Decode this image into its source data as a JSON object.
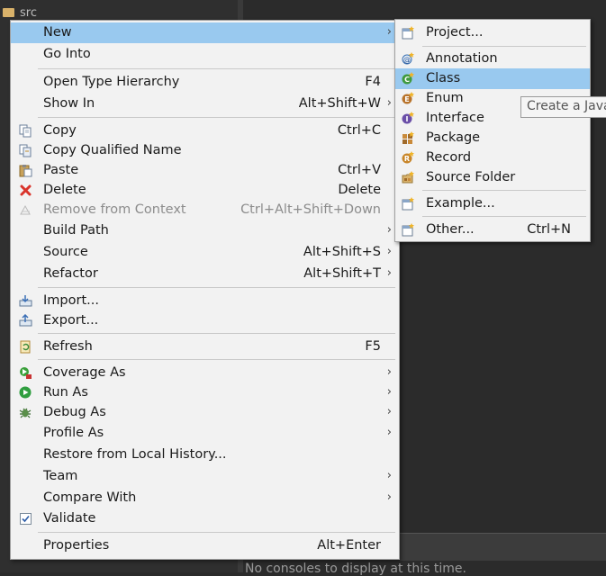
{
  "background": {
    "tree_item_label": "src",
    "console_message": "No consoles to display at this time."
  },
  "context_menu": {
    "items": [
      {
        "label": "New",
        "shortcut": "",
        "submenu": true,
        "icon": "",
        "highlighted": true
      },
      {
        "label": "Go Into",
        "shortcut": ""
      },
      {
        "label": "Open Type Hierarchy",
        "shortcut": "F4"
      },
      {
        "label": "Show In",
        "shortcut": "Alt+Shift+W",
        "submenu": true
      },
      {
        "label": "Copy",
        "shortcut": "Ctrl+C",
        "icon": "copy-icon"
      },
      {
        "label": "Copy Qualified Name",
        "shortcut": "",
        "icon": "copy-qualified-name-icon"
      },
      {
        "label": "Paste",
        "shortcut": "Ctrl+V",
        "icon": "paste-icon"
      },
      {
        "label": "Delete",
        "shortcut": "Delete",
        "icon": "delete-icon"
      },
      {
        "label": "Remove from Context",
        "shortcut": "Ctrl+Alt+Shift+Down",
        "icon": "remove-from-context-icon",
        "disabled": true
      },
      {
        "label": "Build Path",
        "shortcut": "",
        "submenu": true
      },
      {
        "label": "Source",
        "shortcut": "Alt+Shift+S",
        "submenu": true
      },
      {
        "label": "Refactor",
        "shortcut": "Alt+Shift+T",
        "submenu": true
      },
      {
        "label": "Import...",
        "shortcut": "",
        "icon": "import-icon"
      },
      {
        "label": "Export...",
        "shortcut": "",
        "icon": "export-icon"
      },
      {
        "label": "Refresh",
        "shortcut": "F5",
        "icon": "refresh-icon"
      },
      {
        "label": "Coverage As",
        "shortcut": "",
        "submenu": true,
        "icon": "coverage-icon"
      },
      {
        "label": "Run As",
        "shortcut": "",
        "submenu": true,
        "icon": "run-icon"
      },
      {
        "label": "Debug As",
        "shortcut": "",
        "submenu": true,
        "icon": "debug-icon"
      },
      {
        "label": "Profile As",
        "shortcut": "",
        "submenu": true
      },
      {
        "label": "Restore from Local History...",
        "shortcut": ""
      },
      {
        "label": "Team",
        "shortcut": "",
        "submenu": true
      },
      {
        "label": "Compare With",
        "shortcut": "",
        "submenu": true
      },
      {
        "label": "Validate",
        "shortcut": "",
        "icon": "checkbox-icon"
      },
      {
        "label": "Properties",
        "shortcut": "Alt+Enter"
      }
    ]
  },
  "new_submenu": {
    "items": [
      {
        "label": "Project...",
        "shortcut": "",
        "icon": "new-project-icon"
      },
      {
        "label": "Annotation",
        "shortcut": "",
        "icon": "annotation-icon"
      },
      {
        "label": "Class",
        "shortcut": "",
        "icon": "class-icon",
        "highlighted": true
      },
      {
        "label": "Enum",
        "shortcut": "",
        "icon": "enum-icon"
      },
      {
        "label": "Interface",
        "shortcut": "",
        "icon": "interface-icon"
      },
      {
        "label": "Package",
        "shortcut": "",
        "icon": "package-icon"
      },
      {
        "label": "Record",
        "shortcut": "",
        "icon": "record-icon"
      },
      {
        "label": "Source Folder",
        "shortcut": "",
        "icon": "source-folder-icon"
      },
      {
        "label": "Example...",
        "shortcut": "",
        "icon": "new-example-icon"
      },
      {
        "label": "Other...",
        "shortcut": "Ctrl+N",
        "icon": "new-other-icon"
      }
    ]
  },
  "tooltip": {
    "text": "Create a Java"
  },
  "colors": {
    "highlight": "#99c9ef",
    "menu_bg": "#f2f2f2",
    "ide_bg": "#2b2b2b"
  }
}
